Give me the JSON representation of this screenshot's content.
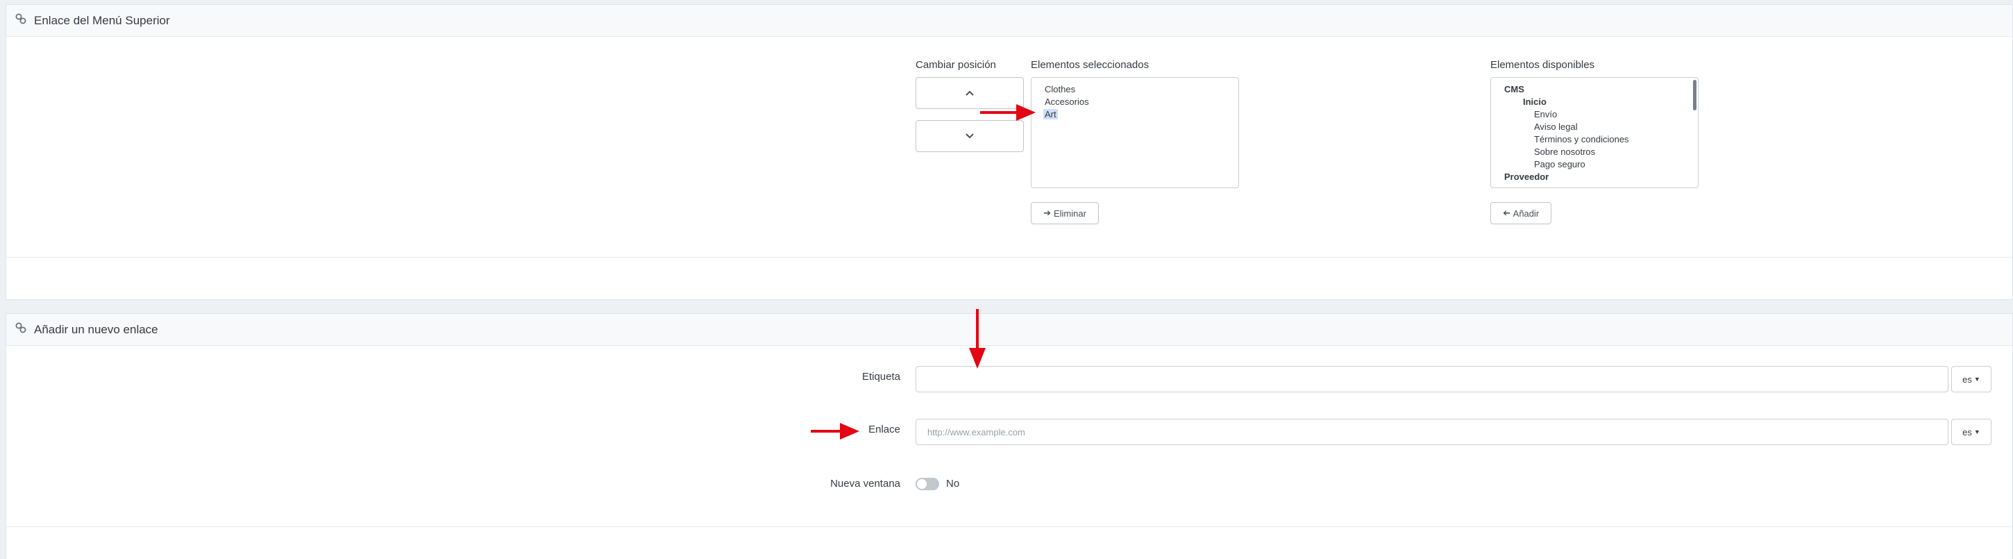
{
  "menu_panel": {
    "title": "Enlace del Menú Superior",
    "change_position_label": "Cambiar posición",
    "selected_label": "Elementos seleccionados",
    "available_label": "Elementos disponibles",
    "selected_items": [
      "Clothes",
      "Accesorios",
      "Art"
    ],
    "available_items": [
      {
        "text": "CMS",
        "level": 0,
        "bold": true
      },
      {
        "text": "Inicio",
        "level": 1,
        "bold": true
      },
      {
        "text": "Envío",
        "level": 2,
        "bold": false
      },
      {
        "text": "Aviso legal",
        "level": 2,
        "bold": false
      },
      {
        "text": "Términos y condiciones",
        "level": 2,
        "bold": false
      },
      {
        "text": "Sobre nosotros",
        "level": 2,
        "bold": false
      },
      {
        "text": "Pago seguro",
        "level": 2,
        "bold": false
      },
      {
        "text": "Proveedor",
        "level": 0,
        "bold": true
      }
    ],
    "remove_button": "Eliminar",
    "add_button": "Añadir"
  },
  "new_link_panel": {
    "title": "Añadir un nuevo enlace",
    "label_field_label": "Etiqueta",
    "label_field_value": "",
    "link_field_label": "Enlace",
    "link_field_placeholder": "http://www.example.com",
    "language": "es",
    "new_window_label": "Nueva ventana",
    "new_window_value": "No"
  },
  "colors": {
    "arrow": "#e30613",
    "selection": "#cde0f7"
  }
}
